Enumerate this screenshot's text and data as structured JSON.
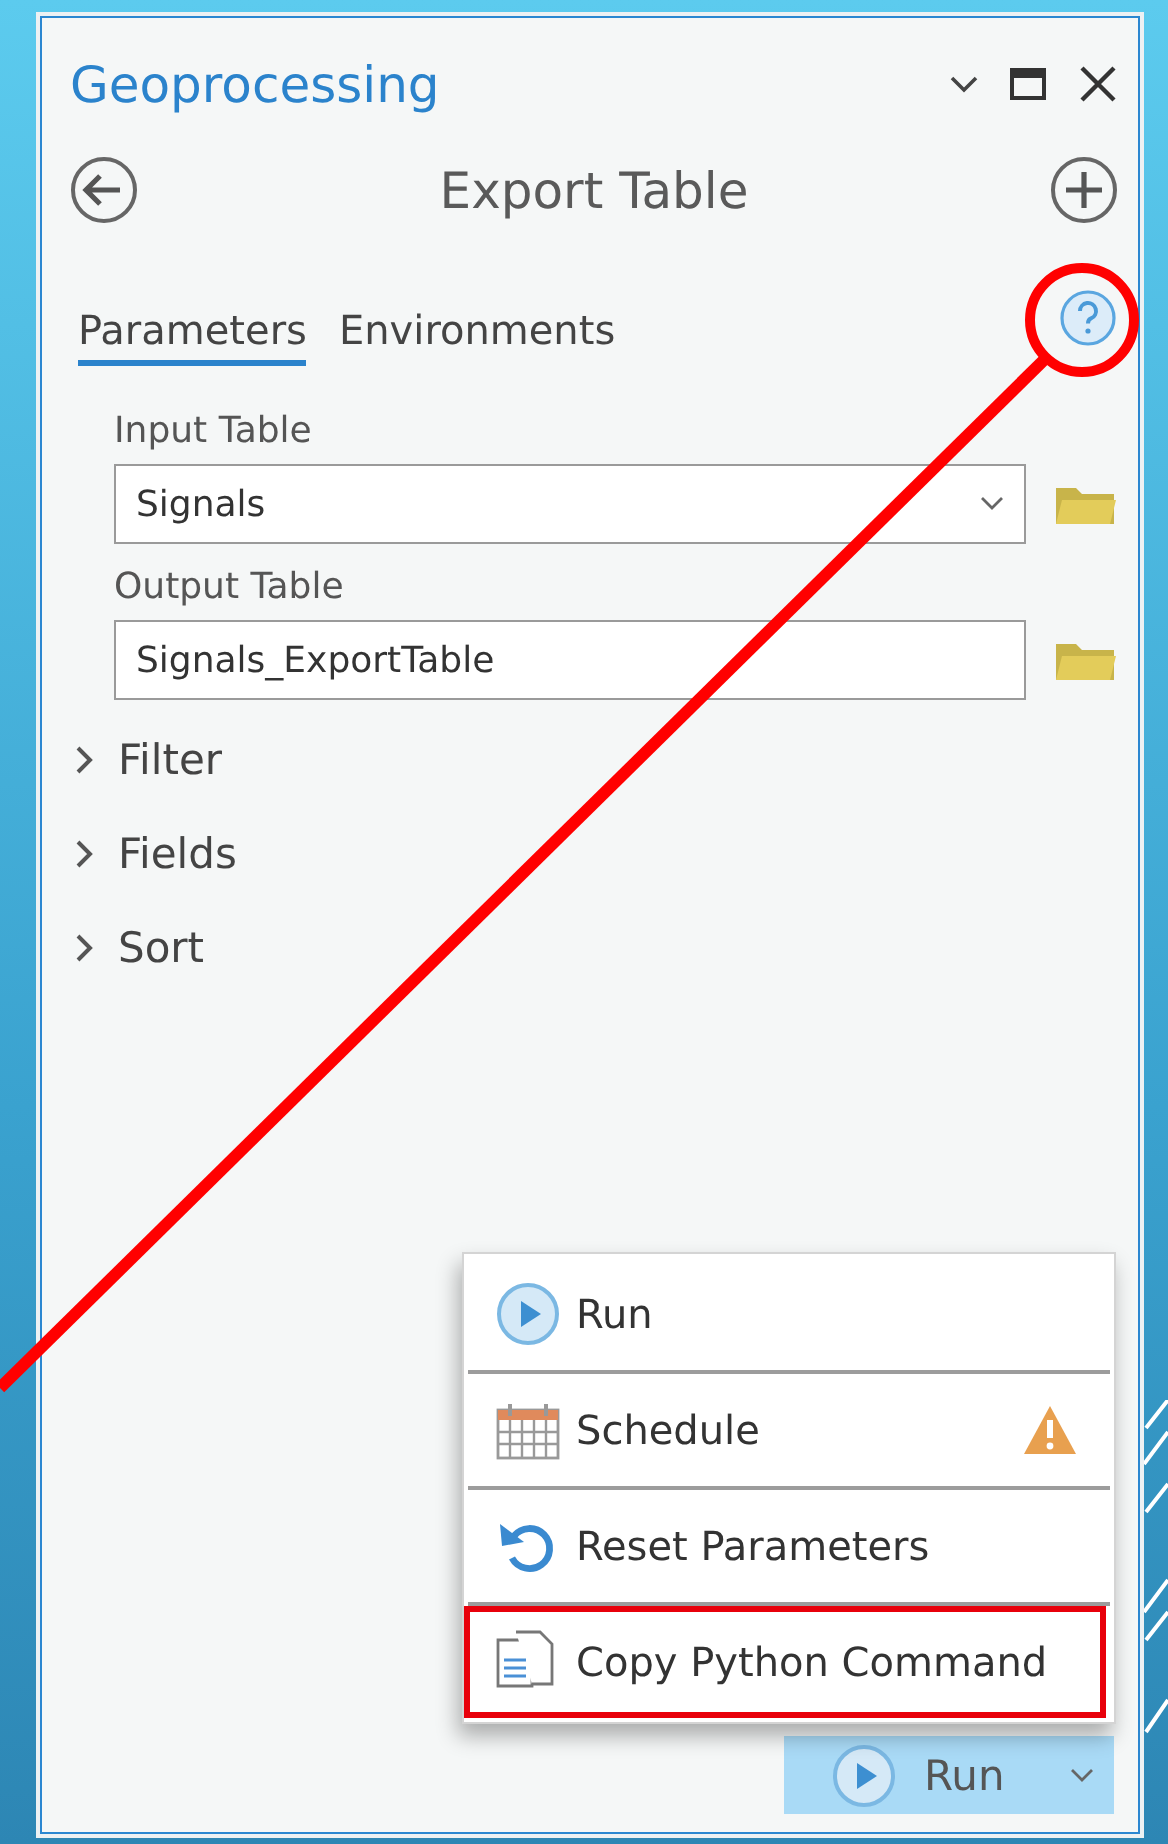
{
  "panel": {
    "title": "Geoprocessing"
  },
  "tool": {
    "title": "Export Table"
  },
  "tabs": [
    {
      "label": "Parameters",
      "selected": true
    },
    {
      "label": "Environments",
      "selected": false
    }
  ],
  "help": {
    "circled": true
  },
  "parameters": [
    {
      "label": "Input Table",
      "value": "Signals",
      "kind": "dropdown"
    },
    {
      "label": "Output Table",
      "value": "Signals_ExportTable",
      "kind": "text"
    }
  ],
  "groups": [
    {
      "label": "Filter",
      "expanded": false
    },
    {
      "label": "Fields",
      "expanded": false
    },
    {
      "label": "Sort",
      "expanded": false
    }
  ],
  "menu": {
    "items": [
      {
        "label": "Run",
        "kind": "run",
        "warning": false,
        "boxed": false
      },
      {
        "label": "Schedule",
        "kind": "schedule",
        "warning": true,
        "boxed": false
      },
      {
        "label": "Reset Parameters",
        "kind": "reset",
        "warning": false,
        "boxed": false
      },
      {
        "label": "Copy Python Command",
        "kind": "copy",
        "warning": false,
        "boxed": true
      }
    ]
  },
  "run_button": {
    "label": "Run"
  }
}
